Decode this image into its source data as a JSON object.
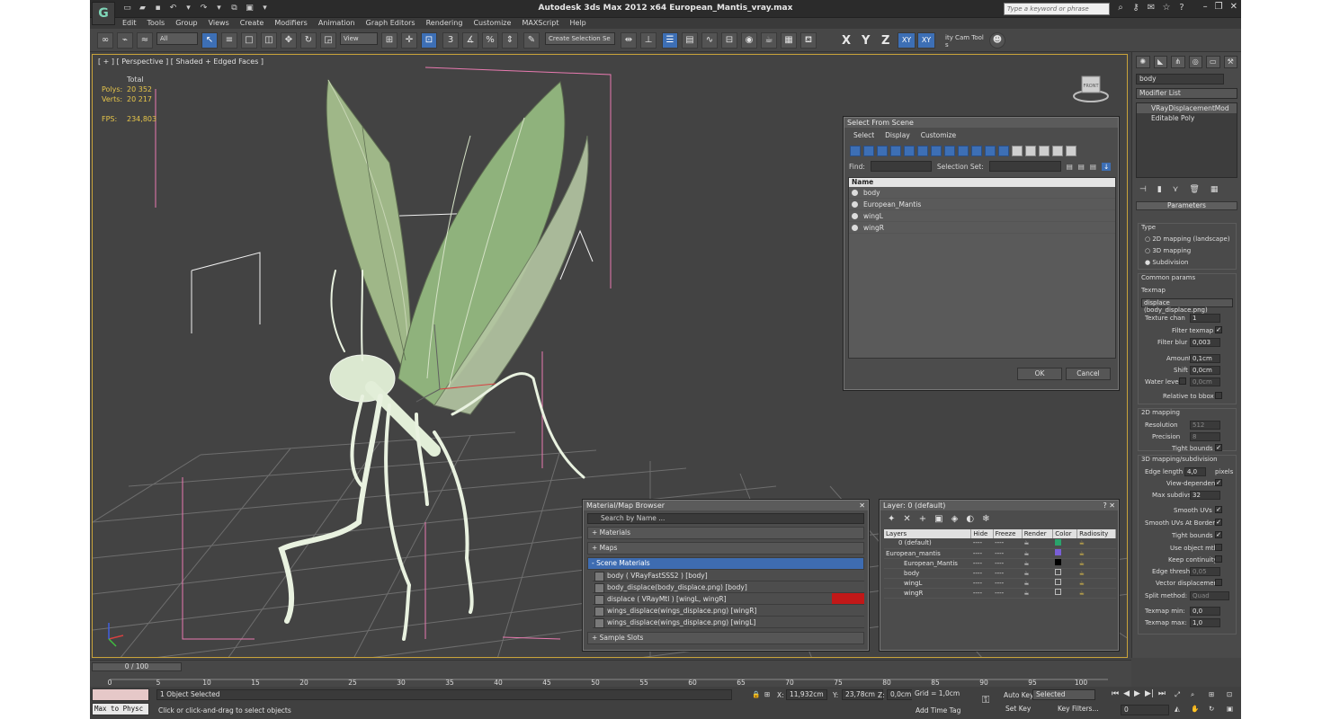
{
  "window": {
    "title": "Autodesk 3ds Max  2012 x64      European_Mantis_vray.max",
    "search_placeholder": "Type a keyword or phrase",
    "logo": "G"
  },
  "menu": [
    "Edit",
    "Tools",
    "Group",
    "Views",
    "Create",
    "Modifiers",
    "Animation",
    "Graph Editors",
    "Rendering",
    "Customize",
    "MAXScript",
    "Help"
  ],
  "toolbar": {
    "filter": "All",
    "ref_coord": "View",
    "selection_set": "Create Selection Se",
    "axes": [
      "X",
      "Y",
      "Z",
      "XY",
      "XY"
    ],
    "cam_tool": "ity Cam Tool s"
  },
  "viewport": {
    "label": "[ + ] [ Perspective ] [ Shaded + Edged Faces ]",
    "stats_total": "Total",
    "stats": [
      {
        "label": "Polys:",
        "value": "20 352"
      },
      {
        "label": "Verts:",
        "value": "20 217"
      }
    ],
    "fps_label": "FPS:",
    "fps_value": "234,803",
    "viewcube_label": "FRONT"
  },
  "select_from_scene": {
    "title": "Select From Scene",
    "menu": [
      "Select",
      "Display",
      "Customize"
    ],
    "find_label": "Find:",
    "selection_set_label": "Selection Set:",
    "column": "Name",
    "items": [
      "body",
      "European_Mantis",
      "wingL",
      "wingR"
    ],
    "ok": "OK",
    "cancel": "Cancel"
  },
  "material_browser": {
    "title": "Material/Map Browser",
    "search_placeholder": "Search by Name ...",
    "sections": [
      "+ Materials",
      "+ Maps",
      "- Scene Materials"
    ],
    "materials": [
      "body  ( VRayFastSSS2 ) [body]",
      "body_displace(body_displace.png) [body]",
      "displace  ( VRayMtl ) [wingL, wingR]",
      "wings_displace(wings_displace.png) [wingR]",
      "wings_displace(wings_displace.png) [wingL]"
    ],
    "sample_slots": "+ Sample Slots"
  },
  "layer_dialog": {
    "title": "Layer: 0 (default)",
    "columns": [
      "Layers",
      "Hide",
      "Freeze",
      "Render",
      "Color",
      "Radiosity"
    ],
    "rows": [
      {
        "name": "0 (default)",
        "hide": "----",
        "freeze": "----",
        "color": "#2aa36b"
      },
      {
        "name": "European_mantis",
        "hide": "----",
        "freeze": "----",
        "color": "#7a5fd6"
      },
      {
        "name": "European_Mantis",
        "hide": "----",
        "freeze": "----",
        "color": "#000000"
      },
      {
        "name": "body",
        "hide": "----",
        "freeze": "----",
        "color": "#3a3a3a"
      },
      {
        "name": "wingL",
        "hide": "----",
        "freeze": "----",
        "color": "#3a3a3a"
      },
      {
        "name": "wingR",
        "hide": "----",
        "freeze": "----",
        "color": "#3a3a3a"
      }
    ]
  },
  "command_panel": {
    "object_name": "body",
    "modifier_list": "Modifier List",
    "stack": [
      "VRayDisplacementMod",
      "Editable Poly"
    ],
    "rollout": "Parameters",
    "type_label": "Type",
    "type_options": [
      "2D mapping (landscape)",
      "3D mapping",
      "Subdivision"
    ],
    "common_params": "Common params",
    "texmap_label": "Texmap",
    "texmap_value": "displace (body_displace.png)",
    "texture_chan_label": "Texture chan",
    "texture_chan": "1",
    "filter_texmap": "Filter texmap",
    "filter_blur_label": "Filter blur",
    "filter_blur": "0,003",
    "amount_label": "Amount",
    "amount": "0,1cm",
    "shift_label": "Shift",
    "shift": "0,0cm",
    "water_level_label": "Water level",
    "water_level": "0,0cm",
    "relative_bbox": "Relative to bbox",
    "map2d": "2D mapping",
    "resolution_label": "Resolution",
    "resolution": "512",
    "precision_label": "Precision",
    "precision": "8",
    "tight_bounds": "Tight bounds",
    "map3d": "3D mapping/subdivision",
    "edge_length_label": "Edge length",
    "edge_length": "4,0",
    "pixels": "pixels",
    "view_dependent": "View-dependent",
    "max_subdivs_label": "Max subdivs",
    "max_subdivs": "32",
    "smooth_uvs": "Smooth UVs",
    "smooth_uvs_borders": "Smooth UVs At Borders",
    "tight_bounds2": "Tight bounds",
    "use_object_mtl": "Use object mtl",
    "keep_continuity": "Keep continuity",
    "edge_thresh_label": "Edge thresh",
    "edge_thresh": "0,05",
    "vector_disp": "Vector displacement",
    "split_method_label": "Split method:",
    "split_method": "Quad",
    "texmap_min_label": "Texmap min:",
    "texmap_min": "0,0",
    "texmap_max_label": "Texmap max:",
    "texmap_max": "1,0"
  },
  "timeline": {
    "slider": "0 / 100",
    "ticks": [
      "0",
      "5",
      "10",
      "15",
      "20",
      "25",
      "30",
      "35",
      "40",
      "45",
      "50",
      "55",
      "60",
      "65",
      "70",
      "75",
      "80",
      "85",
      "90",
      "95",
      "100"
    ]
  },
  "status": {
    "maxscript": "Max to Physc",
    "selected": "1 Object Selected",
    "prompt": "Click or click-and-drag to select objects",
    "x_label": "X:",
    "x": "11,932cm",
    "y_label": "Y:",
    "y": "23,78cm",
    "z_label": "Z:",
    "z": "0,0cm",
    "grid": "Grid = 1,0cm",
    "add_time_tag": "Add Time Tag",
    "auto_key": "Auto Key",
    "set_key": "Set Key",
    "selected_dropdown": "Selected",
    "key_filters": "Key Filters...",
    "frame": "0"
  }
}
